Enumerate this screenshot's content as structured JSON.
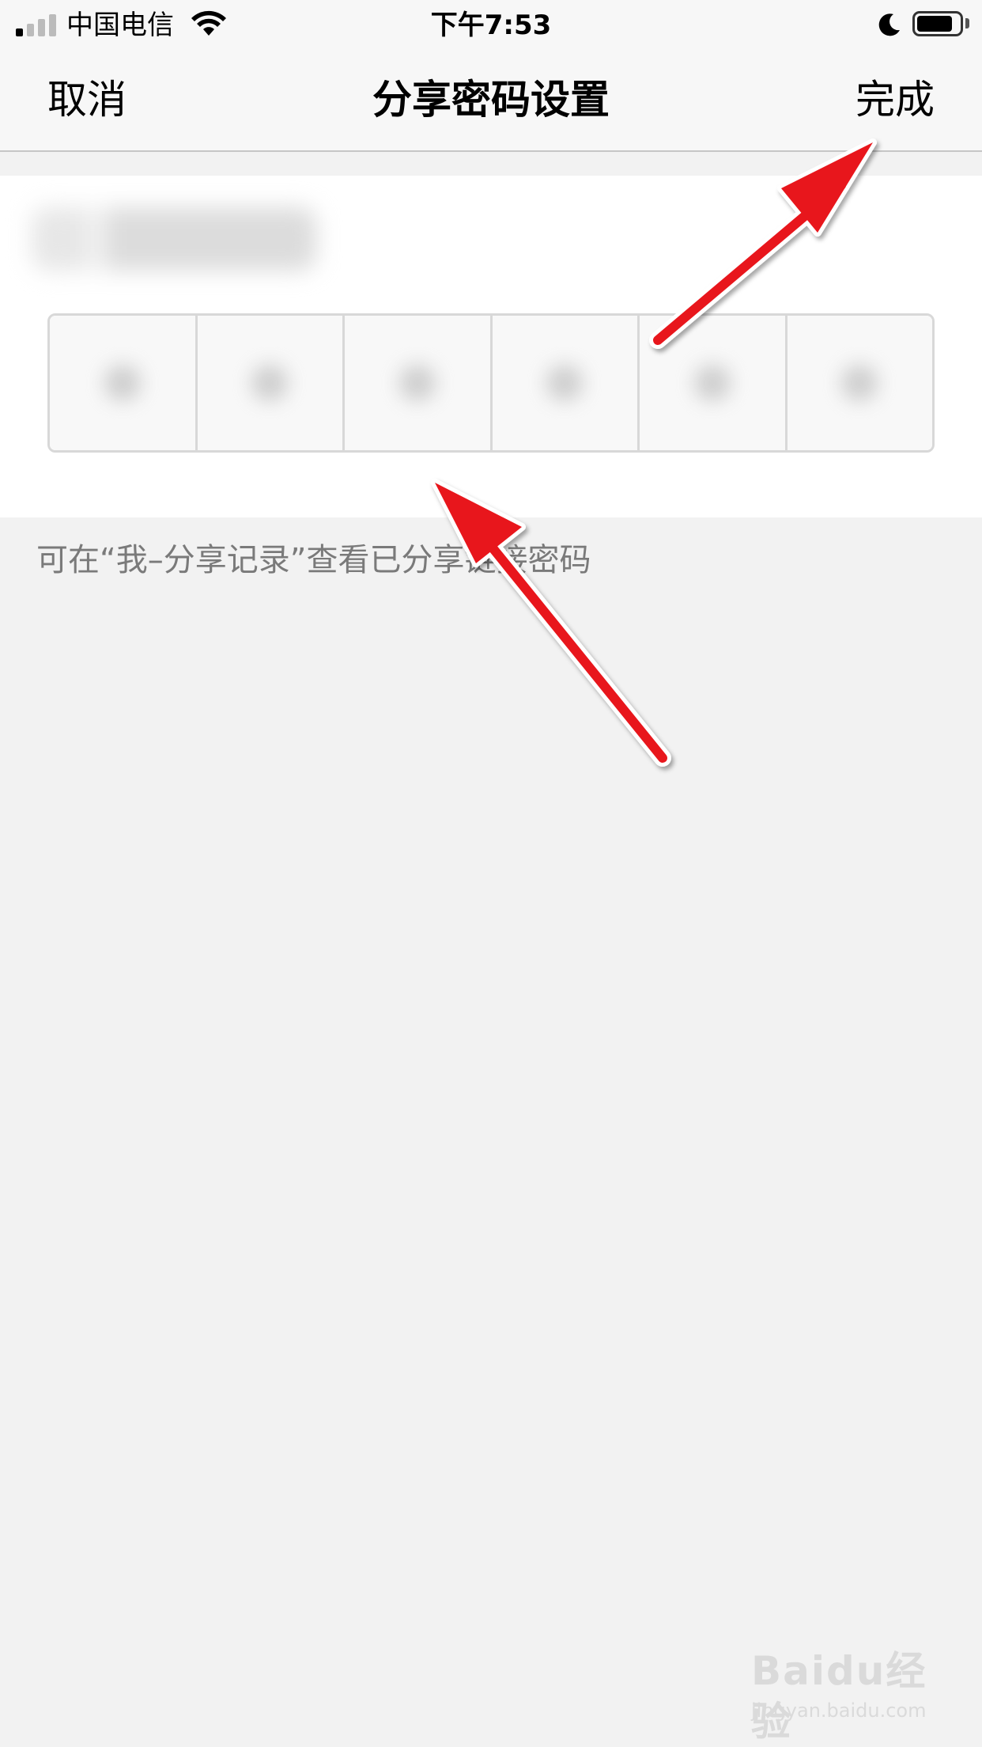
{
  "status_bar": {
    "carrier": "中国电信",
    "time": "下午7:53",
    "battery_level": 0.85,
    "icons": [
      "signal-icon",
      "wifi-icon",
      "moon-icon",
      "battery-icon"
    ]
  },
  "nav": {
    "cancel": "取消",
    "title": "分享密码设置",
    "done": "完成"
  },
  "password": {
    "cell_count": 6
  },
  "hint": "可在“我–分享记录”查看已分享链接密码",
  "watermark": {
    "main": "Baidu经验",
    "sub": "jingyan.baidu.com"
  },
  "colors": {
    "background": "#f2f2f2",
    "nav_background": "#f7f7f7",
    "arrow": "#e8151b",
    "hint_text": "#7a7a7a"
  }
}
